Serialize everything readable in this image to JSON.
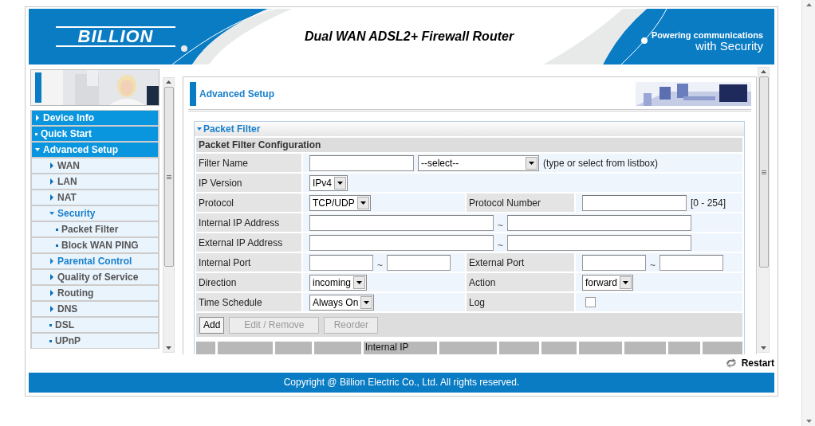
{
  "header": {
    "logo": "BILLION",
    "title": "Dual WAN ADSL2+ Firewall Router",
    "tagline": [
      "Powering communications",
      "with Security"
    ]
  },
  "sidebar": {
    "items": [
      {
        "label": "Device Info",
        "kind": "folder",
        "expanded": false
      },
      {
        "label": "Quick Start",
        "kind": "leaf"
      },
      {
        "label": "Advanced Setup",
        "kind": "folder",
        "expanded": true,
        "children": [
          {
            "label": "WAN",
            "kind": "folder",
            "expanded": false,
            "highlighted": false
          },
          {
            "label": "LAN",
            "kind": "folder",
            "expanded": false,
            "highlighted": false
          },
          {
            "label": "NAT",
            "kind": "folder",
            "expanded": false,
            "highlighted": false
          },
          {
            "label": "Security",
            "kind": "folder",
            "expanded": true,
            "highlighted": true,
            "children": [
              {
                "label": "Packet Filter",
                "kind": "leaf",
                "highlighted": false
              },
              {
                "label": "Block WAN PING",
                "kind": "leaf",
                "highlighted": false
              }
            ]
          },
          {
            "label": "Parental Control",
            "kind": "folder",
            "expanded": false,
            "highlighted": true
          },
          {
            "label": "Quality of Service",
            "kind": "folder",
            "expanded": false,
            "highlighted": false
          },
          {
            "label": "Routing",
            "kind": "folder",
            "expanded": false,
            "highlighted": false
          },
          {
            "label": "DNS",
            "kind": "folder",
            "expanded": false,
            "highlighted": false
          },
          {
            "label": "DSL",
            "kind": "leaf",
            "highlighted": false
          },
          {
            "label": "UPnP",
            "kind": "leaf",
            "highlighted": false
          }
        ]
      }
    ]
  },
  "content": {
    "title": "Advanced Setup",
    "section": {
      "title": "Packet Filter",
      "expanded": true,
      "form_title": "Packet Filter Configuration",
      "rows": [
        {
          "cells": [
            {
              "kind": "label",
              "text": "Filter Name"
            },
            {
              "kind": "wide",
              "parts": [
                {
                  "kind": "input"
                },
                {
                  "kind": "listbox",
                  "value": "--select--"
                },
                {
                  "kind": "note",
                  "text": "(type or select from listbox)"
                }
              ]
            }
          ]
        },
        {
          "cells": [
            {
              "kind": "label",
              "text": "IP Version"
            },
            {
              "kind": "wide",
              "parts": [
                {
                  "kind": "select",
                  "value": "IPv4"
                }
              ]
            }
          ]
        },
        {
          "cells": [
            {
              "kind": "label",
              "text": "Protocol"
            },
            {
              "kind": "value",
              "parts": [
                {
                  "kind": "select",
                  "value": "TCP/UDP"
                }
              ]
            },
            {
              "kind": "label",
              "text": "Protocol Number"
            },
            {
              "kind": "value",
              "parts": [
                {
                  "kind": "input"
                },
                {
                  "kind": "note",
                  "text": "[0 - 254]"
                }
              ]
            }
          ]
        },
        {
          "cells": [
            {
              "kind": "label",
              "text": "Internal IP Address"
            },
            {
              "kind": "wide",
              "parts": [
                {
                  "kind": "address"
                },
                {
                  "kind": "tilde",
                  "text": "~"
                },
                {
                  "kind": "address"
                }
              ]
            }
          ]
        },
        {
          "cells": [
            {
              "kind": "label",
              "text": "External IP Address"
            },
            {
              "kind": "wide",
              "parts": [
                {
                  "kind": "address"
                },
                {
                  "kind": "tilde",
                  "text": "~"
                },
                {
                  "kind": "address"
                }
              ]
            }
          ]
        },
        {
          "cells": [
            {
              "kind": "label",
              "text": "Internal Port"
            },
            {
              "kind": "value",
              "parts": [
                {
                  "kind": "port"
                },
                {
                  "kind": "tilde",
                  "text": "~"
                },
                {
                  "kind": "port"
                }
              ]
            },
            {
              "kind": "label",
              "text": "External Port"
            },
            {
              "kind": "value",
              "parts": [
                {
                  "kind": "port"
                },
                {
                  "kind": "tilde",
                  "text": "~"
                },
                {
                  "kind": "port"
                }
              ]
            }
          ]
        },
        {
          "cells": [
            {
              "kind": "label",
              "text": "Direction"
            },
            {
              "kind": "value",
              "parts": [
                {
                  "kind": "select",
                  "value": "incoming"
                }
              ]
            },
            {
              "kind": "label",
              "text": "Action"
            },
            {
              "kind": "value",
              "parts": [
                {
                  "kind": "select",
                  "value": "forward"
                }
              ]
            }
          ]
        },
        {
          "cells": [
            {
              "kind": "label",
              "text": "Time Schedule"
            },
            {
              "kind": "value",
              "parts": [
                {
                  "kind": "select",
                  "value": "Always On"
                }
              ]
            },
            {
              "kind": "label",
              "text": "Log"
            },
            {
              "kind": "value",
              "parts": [
                {
                  "kind": "checkbox",
                  "checked": false
                }
              ]
            }
          ]
        }
      ],
      "buttons": [
        {
          "label": "Add",
          "disabled": false
        },
        {
          "label": "Edit / Remove",
          "disabled": true
        },
        {
          "label": "Reorder",
          "disabled": true
        }
      ],
      "table": {
        "columns": [
          {
            "kind": "blank"
          },
          {
            "kind": "blank"
          },
          {
            "kind": "blank"
          },
          {
            "kind": "blank"
          },
          {
            "kind": "heading",
            "label": "Internal IP"
          },
          {
            "kind": "blank"
          },
          {
            "kind": "blank"
          },
          {
            "kind": "blank"
          },
          {
            "kind": "blank"
          },
          {
            "kind": "blank"
          },
          {
            "kind": "blank"
          },
          {
            "kind": "blank"
          }
        ]
      }
    }
  },
  "restart": "Restart",
  "footer": "Copyright @ Billion Electric Co., Ltd. All rights reserved."
}
